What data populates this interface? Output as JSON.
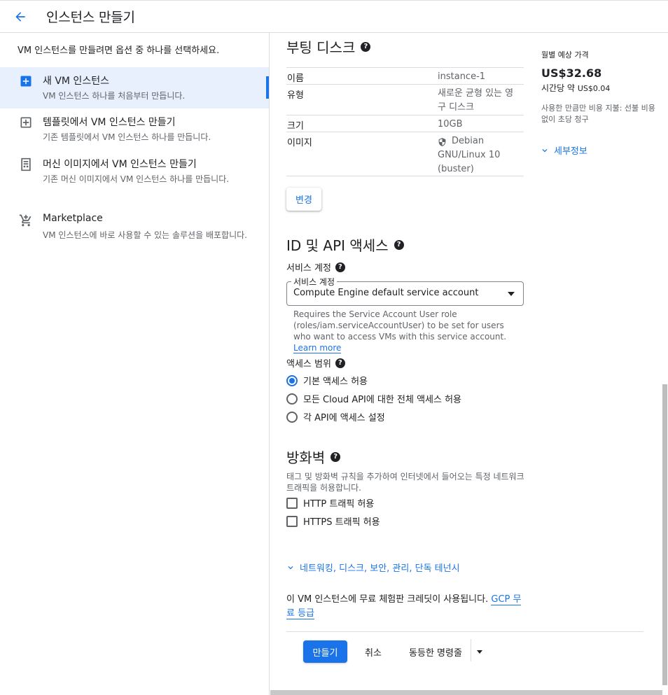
{
  "header": {
    "title": "인스턴스 만들기"
  },
  "left": {
    "intro": "VM 인스턴스를 만들려면 옵션 중 하나를 선택하세요.",
    "options": [
      {
        "title": "새 VM 인스턴스",
        "desc": "VM 인스턴스 하나를 처음부터 만듭니다.",
        "icon": "add-box-icon"
      },
      {
        "title": "템플릿에서 VM 인스턴스 만들기",
        "desc": "기존 템플릿에서 VM 인스턴스 하나를 만듭니다.",
        "icon": "add-box-outline-icon"
      },
      {
        "title": "머신 이미지에서 VM 인스턴스 만들기",
        "desc": "기존 머신 이미지에서 VM 인스턴스 하나를 만듭니다.",
        "icon": "machine-image-icon"
      },
      {
        "title": "Marketplace",
        "desc": "VM 인스턴스에 바로 사용할 수 있는 솔루션을 배포합니다.",
        "icon": "cart-icon"
      }
    ]
  },
  "boot": {
    "title": "부팅 디스크",
    "rows": [
      {
        "label": "이름",
        "value": "instance-1"
      },
      {
        "label": "유형",
        "value": "새로운 균형 있는 영구 디스크"
      },
      {
        "label": "크기",
        "value": "10GB"
      },
      {
        "label": "이미지",
        "value": "Debian GNU/Linux 10 (buster)"
      }
    ],
    "change": "변경"
  },
  "identity": {
    "title": "ID 및 API 액세스",
    "service_label": "서비스 계정",
    "select_label": "서비스 계정",
    "select_value": "Compute Engine default service account",
    "hint": "Requires the Service Account User role (roles/iam.serviceAccountUser) to be set for users who want to access VMs with this service account.",
    "hint_link": "Learn more",
    "scope_label": "액세스 범위",
    "scopes": [
      "기본 액세스 허용",
      "모든 Cloud API에 대한 전체 액세스 허용",
      "각 API에 액세스 설정"
    ]
  },
  "firewall": {
    "title": "방화벽",
    "desc": "태그 및 방화벽 규칙을 추가하여 인터넷에서 들어오는 특정 네트워크 트래픽을 허용합니다.",
    "http": "HTTP 트래픽 허용",
    "https": "HTTPS 트래픽 허용"
  },
  "more": "네트워킹, 디스크, 보안, 관리, 단독 테넌시",
  "credit": {
    "text": "이 VM 인스턴스에 무료 체험판 크레딧이 사용됩니다. ",
    "link": "GCP 무료 등급"
  },
  "actions": {
    "create": "만들기",
    "cancel": "취소",
    "command": "동등한 명령줄"
  },
  "price": {
    "title": "월별 예상 가격",
    "value": "US$32.68",
    "hour_prefix": "시간당 약",
    "hour_value": "US$0.04",
    "note": "사용한 만큼만 비용 지불: 선불 비용 없이 초당 청구",
    "details": "세부정보"
  },
  "colors": {
    "accent": "#1a73e8",
    "active_bg": "#e8f0fe"
  }
}
